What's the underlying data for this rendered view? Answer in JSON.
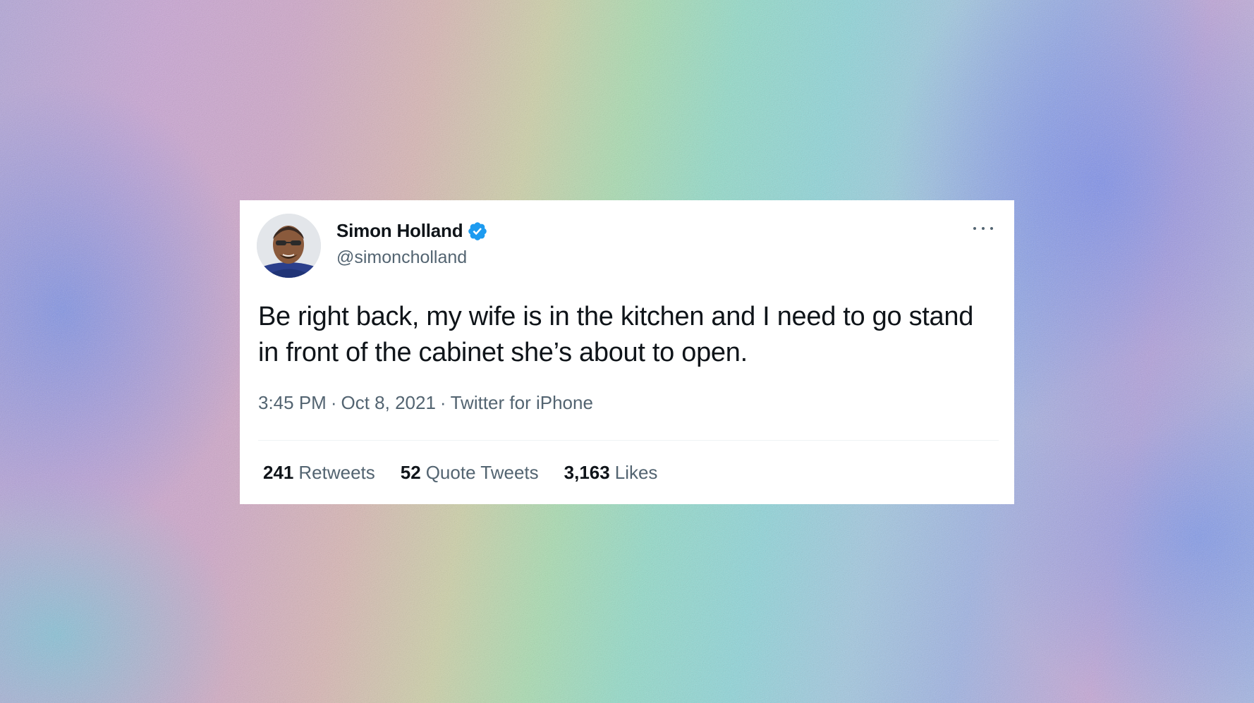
{
  "tweet": {
    "author": {
      "name": "Simon Holland",
      "handle": "@simoncholland",
      "verified": true,
      "verified_color": "#1d9bf0"
    },
    "text": "Be right back, my wife is in the kitchen and I need to go stand in front of the cabinet she’s about to open.",
    "time": "3:45 PM",
    "date": "Oct 8, 2021",
    "separator": "·",
    "source": "Twitter for iPhone",
    "stats": {
      "retweets": {
        "count": "241",
        "label": "Retweets"
      },
      "quote_tweets": {
        "count": "52",
        "label": "Quote Tweets"
      },
      "likes": {
        "count": "3,163",
        "label": "Likes"
      }
    },
    "more_icon": "more-horizontal-icon"
  },
  "colors": {
    "text_primary": "#0f1419",
    "text_secondary": "#536471",
    "card_background": "#ffffff"
  }
}
